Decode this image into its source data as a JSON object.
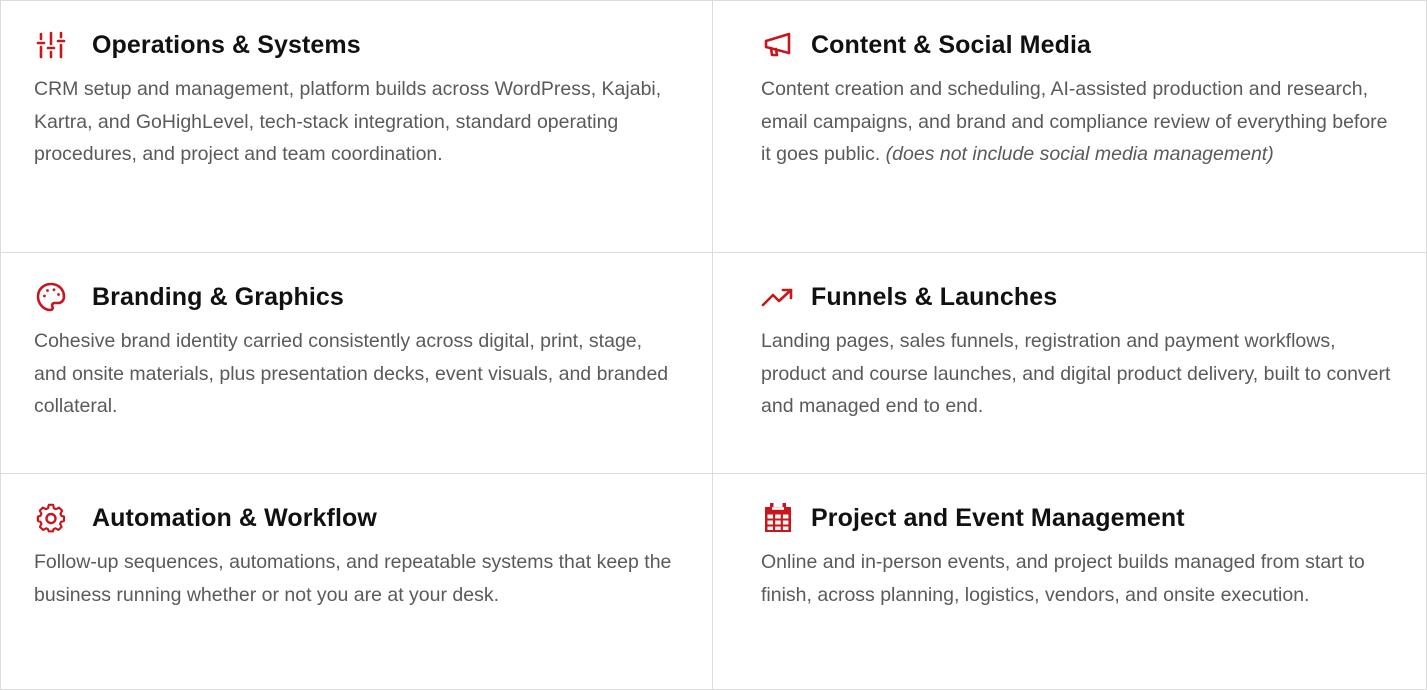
{
  "accent_color": "#c8161d",
  "cards": [
    {
      "icon": "sliders-icon",
      "title": "Operations & Systems",
      "description": "CRM setup and management, platform builds across WordPress, Kajabi, Kartra, and GoHighLevel, tech-stack integration, standard operating procedures, and project and team coordination.",
      "note": ""
    },
    {
      "icon": "megaphone-icon",
      "title": "Content & Social Media",
      "description": "Content creation and scheduling, AI-assisted production and research, email campaigns, and brand and compliance review of everything before it goes public.",
      "note": "(does not include social media management)"
    },
    {
      "icon": "palette-icon",
      "title": "Branding & Graphics",
      "description": "Cohesive brand identity carried consistently across digital, print, stage, and onsite materials, plus presentation decks, event visuals, and branded collateral.",
      "note": ""
    },
    {
      "icon": "trend-up-icon",
      "title": "Funnels & Launches",
      "description": "Landing pages, sales funnels, registration and payment workflows, product and course launches, and digital product delivery, built to convert and managed end to end.",
      "note": ""
    },
    {
      "icon": "gear-icon",
      "title": "Automation & Workflow",
      "description": "Follow-up sequences, automations, and repeatable systems that keep the business running whether or not you are at your desk.",
      "note": ""
    },
    {
      "icon": "calendar-icon",
      "title": "Project and Event Management",
      "description": "Online and in-person events, and project builds managed from start to finish, across planning, logistics, vendors, and onsite execution.",
      "note": ""
    }
  ]
}
